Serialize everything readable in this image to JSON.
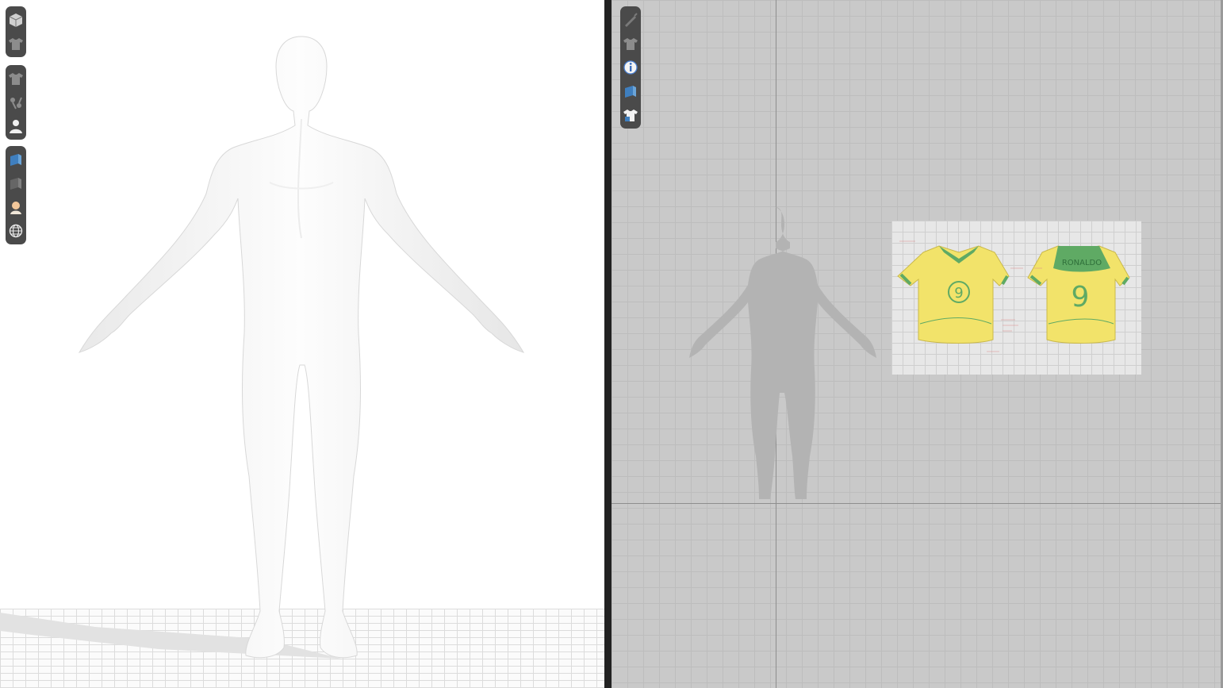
{
  "viewport_3d": {
    "toolbar_groups": [
      [
        "display-mode-icon",
        "garment-display-icon"
      ],
      [
        "garment-icon",
        "pins-icon",
        "avatar-icon"
      ],
      [
        "texture-icon",
        "shadow-icon",
        "skin-icon",
        "environment-globe-icon"
      ]
    ]
  },
  "viewport_2d": {
    "toolbar": [
      "pen-tool-icon",
      "garment-icon",
      "info-icon",
      "texture-icon",
      "pattern-garment-icon"
    ],
    "reference_image": {
      "back_name": "RONALDO",
      "front_number": "9",
      "back_number": "9"
    }
  },
  "colors": {
    "jersey_yellow": "#f2e36a",
    "jersey_green": "#5faa64",
    "toolbar_bg": "#4a4a4a",
    "grid_bg": "#c9c9c9"
  }
}
